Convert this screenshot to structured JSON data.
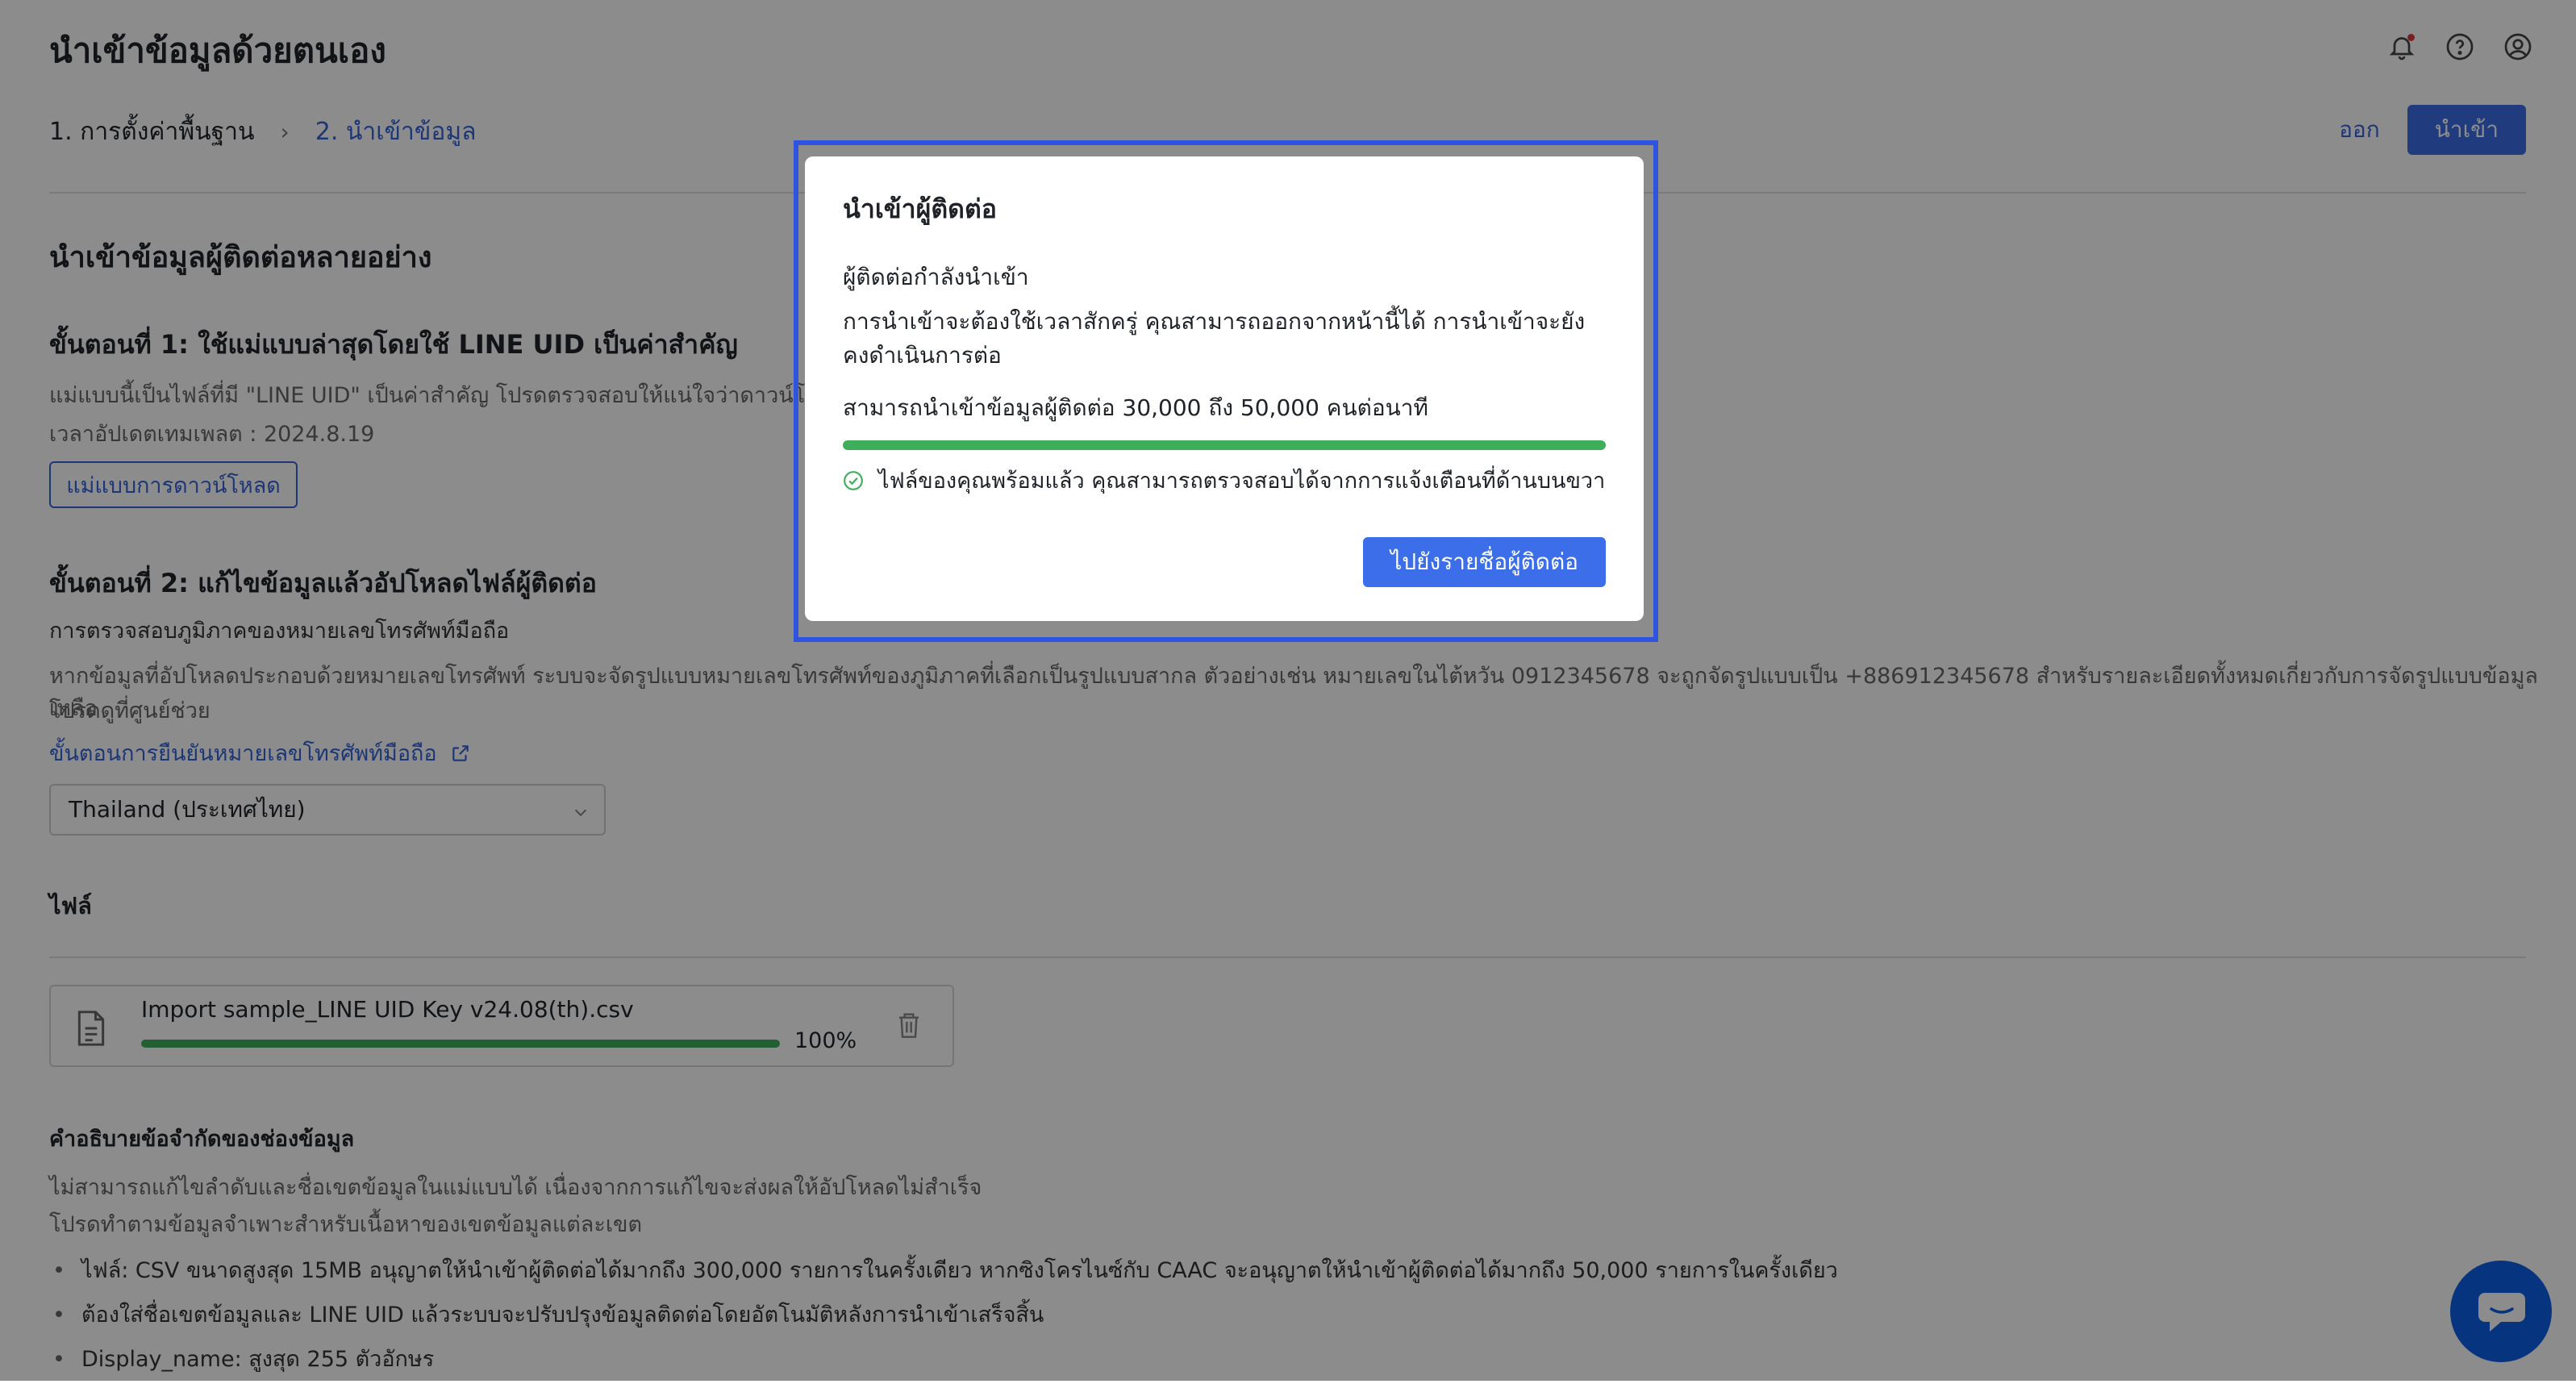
{
  "header": {
    "title": "นำเข้าข้อมูลด้วยตนเอง",
    "icons": [
      "bell-icon",
      "help-icon",
      "user-icon"
    ]
  },
  "steps": [
    {
      "label": "1. การตั้งค่าพื้นฐาน"
    },
    {
      "label": "2. นำเข้าข้อมูล"
    }
  ],
  "steps_separator": "›",
  "top_actions": {
    "exit_label": "ออก",
    "import_label": "นำเข้า"
  },
  "section": {
    "title": "นำเข้าข้อมูลผู้ติดต่อหลายอย่าง",
    "step1": {
      "title": "ขั้นตอนที่ 1: ใช้แม่แบบล่าสุดโดยใช้ LINE UID เป็นค่าสำคัญ",
      "desc": "แม่แบบนี้เป็นไฟล์ที่มี \"LINE UID\" เป็นค่าสำคัญ โปรดตรวจสอบให้แน่ใจว่าดาวน์โหลดแ",
      "updated": "เวลาอัปเดตเทมเพลต : 2024.8.19",
      "download_label": "แม่แบบการดาวน์โหลด"
    },
    "step2": {
      "title": "ขั้นตอนที่ 2: แก้ไขข้อมูลแล้วอัปโหลดไฟล์ผู้ติดต่อ",
      "region_title": "การตรวจสอบภูมิภาคของหมายเลขโทรศัพท์มือถือ",
      "desc_line1": "หากข้อมูลที่อัปโหลดประกอบด้วยหมายเลขโทรศัพท์ ระบบจะจัดรูปแบบหมายเลขโทรศัพท์ของภูมิภาคที่เลือกเป็นรูปแบบสากล ตัวอย่างเช่น หมายเลขในไต้หวัน 0912345678 จะถูกจัดรูปแบบเป็น +886912345678 สำหรับรายละเอียดทั้งหมดเกี่ยวกับการจัดรูปแบบข้อมูล โปรดดูที่ศูนย์ช่วย",
      "desc_line2": "เหลือ",
      "verify_link": "ขั้นตอนการยืนยันหมายเลขโทรศัพท์มือถือ",
      "region_value": "Thailand (ประเทศไทย)"
    },
    "file_label": "ไฟล์",
    "file": {
      "name": "Import sample_LINE UID Key v24.08(th).csv",
      "progress_text": "100%",
      "progress": 1.0
    },
    "limits": {
      "title": "คำอธิบายข้อจำกัดของช่องข้อมูล",
      "line1": "ไม่สามารถแก้ไขลำดับและชื่อเขตข้อมูลในแม่แบบได้ เนื่องจากการแก้ไขจะส่งผลให้อัปโหลดไม่สำเร็จ",
      "line2": "โปรดทำตามข้อมูลจำเพาะสำหรับเนื้อหาของเขตข้อมูลแต่ละเขต",
      "bullets": [
        "ไฟล์: CSV ขนาดสูงสุด 15MB อนุญาตให้นำเข้าผู้ติดต่อได้มากถึง 300,000 รายการในครั้งเดียว หากซิงโครไนซ์กับ CAAC จะอนุญาตให้นำเข้าผู้ติดต่อได้มากถึง 50,000 รายการในครั้งเดียว",
        "ต้องใส่ชื่อเขตข้อมูลและ LINE UID แล้วระบบจะปรับปรุงข้อมูลติดต่อโดยอัตโนมัติหลังการนำเข้าเสร็จสิ้น",
        "Display_name: สูงสุด 255 ตัวอักษร"
      ]
    }
  },
  "modal": {
    "title": "นำเข้าผู้ติดต่อ",
    "subtitle": "ผู้ติดต่อกำลังนำเข้า",
    "desc": "การนำเข้าจะต้องใช้เวลาสักครู่ คุณสามารถออกจากหน้านี้ได้ การนำเข้าจะยังคงดำเนินการต่อ",
    "rate": "สามารถนำเข้าข้อมูลผู้ติดต่อ 30,000 ถึง 50,000 คนต่อนาที",
    "progress": 1.0,
    "ready": "ไฟล์ของคุณพร้อมแล้ว คุณสามารถตรวจสอบได้จากการแจ้งเตือนที่ด้านบนขวา",
    "button": "ไปยังรายชื่อผู้ติดต่อ"
  },
  "colors": {
    "accent": "#3b6ee8",
    "success": "#3fae5b",
    "highlight": "#2f55e0"
  }
}
